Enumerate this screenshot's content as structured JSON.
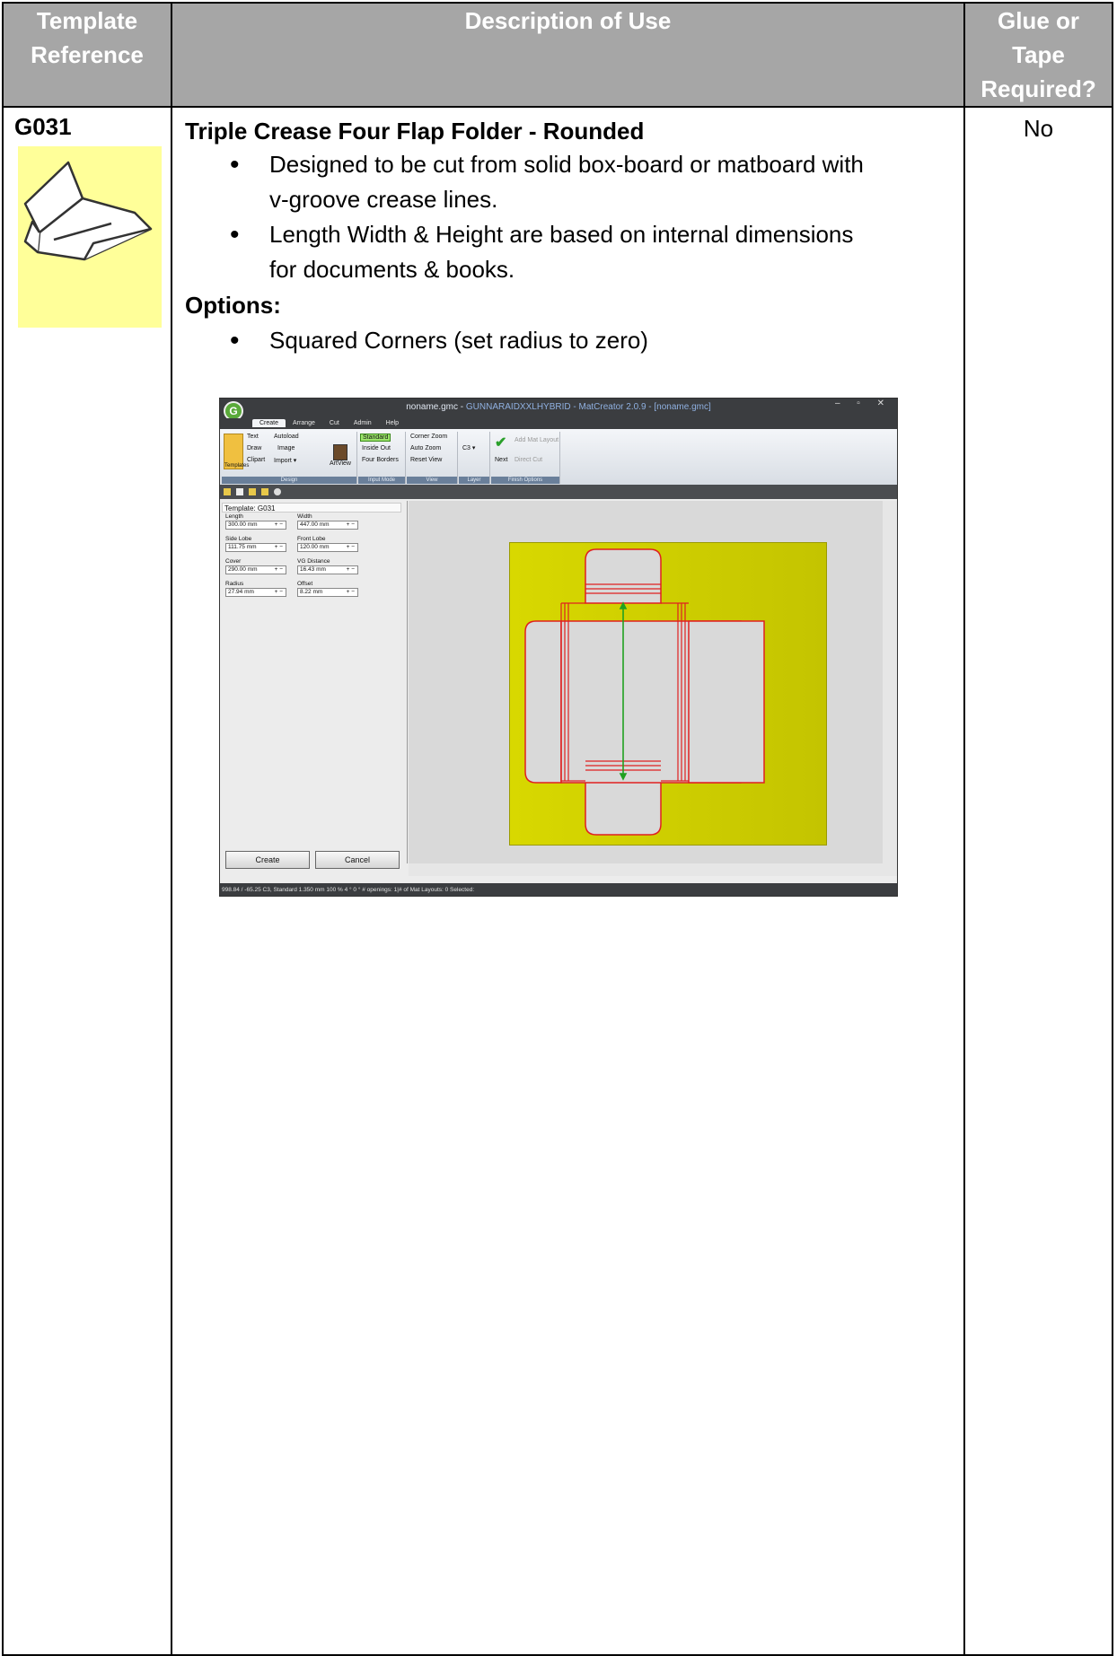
{
  "header": {
    "col1": [
      "Template",
      "Reference"
    ],
    "col2": "Description of Use",
    "col3": [
      "Glue or",
      "Tape",
      "Required?"
    ]
  },
  "row": {
    "reference": "G031",
    "thumbnail_icon": "folder-thumbnail-icon",
    "title": "Triple Crease Four Flap Folder - Rounded",
    "bullets": [
      [
        "Designed to be cut from solid box-board or matboard with",
        "v-groove crease lines."
      ],
      [
        "Length Width & Height are based on internal dimensions",
        "for documents & books."
      ]
    ],
    "options_label": "Options:",
    "options": [
      "Squared Corners (set radius to zero)"
    ],
    "glue": "No"
  },
  "screenshot": {
    "window_title": "noname.gmc - ",
    "window_title_app": "GUNNARAIDXXLHYBRID - MatCreator 2.0.9 - [noname.gmc]",
    "logo_letter": "G",
    "window_buttons": "– ▫ ✕",
    "menu": [
      "Create",
      "Arrange",
      "Cut",
      "Admin",
      "Help"
    ],
    "ribbon": {
      "templates": "Templates",
      "text": "Text",
      "autoload": "Autoload",
      "draw": "Draw",
      "image": "Image",
      "clipart": "Clipart",
      "import": "Import ▾",
      "artview": "ArtView",
      "design": "Design",
      "standard": "Standard",
      "inside_out": "Inside Out",
      "four_borders": "Four Borders",
      "input_mode": "Input Mode",
      "corner_zoom": "Corner Zoom",
      "auto_zoom": "Auto Zoom",
      "reset_view": "Reset View",
      "view": "View",
      "c3": "C3 ▾",
      "layer": "Layer",
      "next": "Next",
      "add_mat_layout": "Add Mat Layout",
      "direct_cut": "Direct Cut",
      "finish_options": "Finish Options"
    },
    "panel_title": "Template: G031",
    "fields": [
      {
        "label": "Length",
        "value": "300.00 mm"
      },
      {
        "label": "Width",
        "value": "447.00 mm"
      },
      {
        "label": "Side Lobe",
        "value": "111.75 mm"
      },
      {
        "label": "Front Lobe",
        "value": "120.00 mm"
      },
      {
        "label": "Cover",
        "value": "290.00 mm"
      },
      {
        "label": "VG Distance",
        "value": "16.43 mm"
      },
      {
        "label": "Radius",
        "value": "27.94 mm"
      },
      {
        "label": "Offset",
        "value": "8.22 mm"
      }
    ],
    "stepper": "+ −",
    "create_button": "Create",
    "cancel_button": "Cancel",
    "status": "998.84 / -65.25     C3, Standard   1.350 mm   100 %   4 °   0 °   # openings: 1|# of Mat Layouts: 0   Selected:",
    "colors": {
      "mat": "#cccc00",
      "cut_line": "#e02020",
      "dimension": "#20a020"
    }
  }
}
